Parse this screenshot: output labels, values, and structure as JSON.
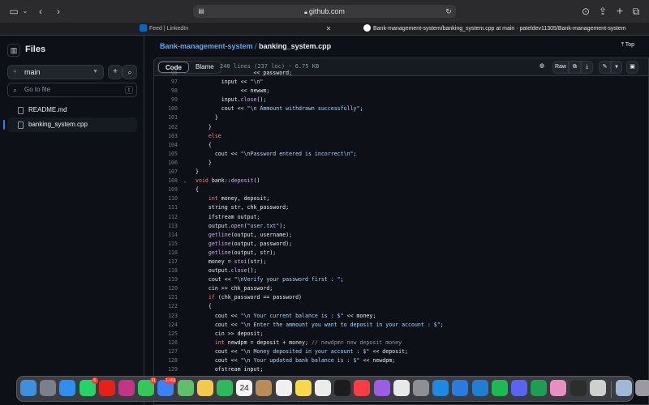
{
  "browser": {
    "url": "github.com",
    "tabs": [
      {
        "title": "Feed | LinkedIn",
        "icon": "linkedin-icon",
        "color": "#0a66c2"
      },
      {
        "title": "Bank-management-system/banking_system.cpp at main · pateldev11305/Bank-management-system",
        "icon": "github-icon",
        "color": "#ffffff"
      }
    ]
  },
  "sidebar": {
    "title": "Files",
    "branch": "main",
    "search_placeholder": "Go to file",
    "search_shortcut": "t",
    "files": [
      {
        "name": "README.md",
        "active": false
      },
      {
        "name": "banking_system.cpp",
        "active": true
      }
    ]
  },
  "header": {
    "repo": "Bank-management-system",
    "separator": "/",
    "file": "banking_system.cpp",
    "top_link": "Top"
  },
  "code_header": {
    "tab_code": "Code",
    "tab_blame": "Blame",
    "meta": "240 lines (237 loc) · 6.75 KB",
    "raw_label": "Raw"
  },
  "code_lines": [
    {
      "n": "96",
      "html": "                  << password;"
    },
    {
      "n": "97",
      "html": "        input << <span class=\"s\">\"\\n\"</span>"
    },
    {
      "n": "98",
      "html": "              << newwm;"
    },
    {
      "n": "99",
      "html": "        input.<span class=\"f\">close</span>();"
    },
    {
      "n": "100",
      "html": "        cout << <span class=\"s\">\"\\n Ammount withdrawn successfully\"</span>;"
    },
    {
      "n": "101",
      "html": "      }"
    },
    {
      "n": "102",
      "html": "    }"
    },
    {
      "n": "103",
      "html": "    <span class=\"k\">else</span>"
    },
    {
      "n": "104",
      "html": "    {"
    },
    {
      "n": "105",
      "html": "      cout << <span class=\"s\">\"\\nPassword entered is incorrect\\n\"</span>;"
    },
    {
      "n": "106",
      "html": "    }"
    },
    {
      "n": "107",
      "html": "}"
    },
    {
      "n": "108",
      "html": "<span class=\"k\">void</span> bank::<span class=\"f\">deposit</span>()",
      "fold": true
    },
    {
      "n": "109",
      "html": "{"
    },
    {
      "n": "110",
      "html": "    <span class=\"k\">int</span> money, deposit;"
    },
    {
      "n": "111",
      "html": "    string str, chk_password;"
    },
    {
      "n": "112",
      "html": "    ifstream output;"
    },
    {
      "n": "113",
      "html": "    output.<span class=\"f\">open</span>(<span class=\"s\">\"user.txt\"</span>);"
    },
    {
      "n": "114",
      "html": "    <span class=\"f\">getline</span>(output, username);"
    },
    {
      "n": "115",
      "html": "    <span class=\"f\">getline</span>(output, password);"
    },
    {
      "n": "116",
      "html": "    <span class=\"f\">getline</span>(output, str);"
    },
    {
      "n": "117",
      "html": "    money = <span class=\"f\">stoi</span>(str);"
    },
    {
      "n": "118",
      "html": "    output.<span class=\"f\">close</span>();"
    },
    {
      "n": "119",
      "html": "    cout << <span class=\"s\">\"\\nVerify your password first : \"</span>;"
    },
    {
      "n": "120",
      "html": "    cin >> chk_password;"
    },
    {
      "n": "121",
      "html": "    <span class=\"k\">if</span> (chk_password == password)"
    },
    {
      "n": "122",
      "html": "    {"
    },
    {
      "n": "123",
      "html": "      cout << <span class=\"s\">\"\\n Your current balance is : $\"</span> << money;"
    },
    {
      "n": "124",
      "html": "      cout << <span class=\"s\">\"\\n Enter the ammount you want to deposit in your account : $\"</span>;"
    },
    {
      "n": "125",
      "html": "      cin >> deposit;"
    },
    {
      "n": "126",
      "html": "      <span class=\"k\">int</span> newdpm = deposit + money; <span class=\"c\">// newdpm= new deposit money</span>"
    },
    {
      "n": "127",
      "html": "      cout << <span class=\"s\">\"\\n Money deposited in your account : $\"</span> << deposit;"
    },
    {
      "n": "128",
      "html": "      cout << <span class=\"s\">\"\\n Your updated bank balance is : $\"</span> << newdpm;"
    },
    {
      "n": "129",
      "html": "      ofstream input;"
    }
  ],
  "dock": {
    "badges": {
      "whatsapp": "6",
      "instagram": "31",
      "mail": "1,463"
    },
    "calendar_day": "24",
    "apps": [
      {
        "name": "finder-icon",
        "color": "#3d8fe0"
      },
      {
        "name": "launchpad-icon",
        "color": "#7a7f8c"
      },
      {
        "name": "safari-icon",
        "color": "#2f8ff0"
      },
      {
        "name": "whatsapp-icon",
        "color": "#25d366",
        "badge": "whatsapp"
      },
      {
        "name": "youtube-icon",
        "color": "#e62117"
      },
      {
        "name": "instagram-icon",
        "color": "#c13584"
      },
      {
        "name": "messages-icon",
        "color": "#34c759",
        "badge": "instagram"
      },
      {
        "name": "mail-icon",
        "color": "#3b82f6",
        "badge": "mail"
      },
      {
        "name": "maps-icon",
        "color": "#5fbf6a"
      },
      {
        "name": "photos-icon",
        "color": "#f2c94c"
      },
      {
        "name": "facetime-icon",
        "color": "#2fb85a"
      },
      {
        "name": "calendar-icon",
        "color": "#f5f5f5"
      },
      {
        "name": "contacts-icon",
        "color": "#b88b57"
      },
      {
        "name": "reminders-icon",
        "color": "#f0f0f0"
      },
      {
        "name": "notes-icon",
        "color": "#f6d84a"
      },
      {
        "name": "freeform-icon",
        "color": "#ececec"
      },
      {
        "name": "appletv-icon",
        "color": "#1c1c1e"
      },
      {
        "name": "music-icon",
        "color": "#fc3c44"
      },
      {
        "name": "podcasts-icon",
        "color": "#9b5de5"
      },
      {
        "name": "news-icon",
        "color": "#e8e8e8"
      },
      {
        "name": "settings-icon",
        "color": "#8e8e93"
      },
      {
        "name": "appstore-icon",
        "color": "#1e88e5"
      },
      {
        "name": "xcode-icon",
        "color": "#2a7be0"
      },
      {
        "name": "vscode-icon",
        "color": "#1f7fd0"
      },
      {
        "name": "spotify-icon",
        "color": "#1db954"
      },
      {
        "name": "discord-icon",
        "color": "#5865f2"
      },
      {
        "name": "excel-icon",
        "color": "#1f9d55"
      },
      {
        "name": "tabs-icon",
        "color": "#e88fc0"
      },
      {
        "name": "terminal-icon",
        "color": "#2d2d2d"
      },
      {
        "name": "preview-icon",
        "color": "#cfcfcf"
      },
      {
        "name": "downloads-icon",
        "color": "#a0b8d8"
      },
      {
        "name": "trash-icon",
        "color": "#9a9aa0"
      }
    ]
  }
}
